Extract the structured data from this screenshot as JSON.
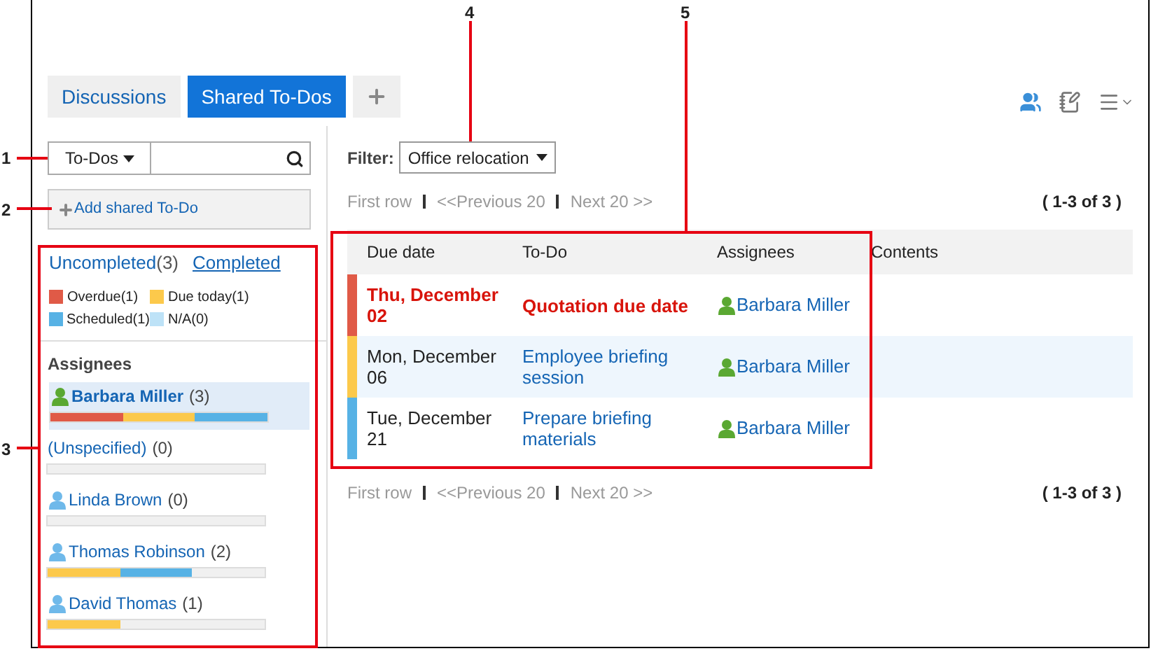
{
  "tabs": [
    {
      "label": "Discussions",
      "selected": false
    },
    {
      "label": "Shared To-Dos",
      "selected": true
    }
  ],
  "search": {
    "menu_label": "To-Dos"
  },
  "add_button": {
    "label": "Add shared To-Do"
  },
  "status_links": [
    {
      "label": "Uncompleted",
      "count": "(3)",
      "selected": true
    },
    {
      "label": "Completed",
      "selected": false
    }
  ],
  "legend": [
    {
      "label": "Overdue(1)",
      "color": "#e05a47"
    },
    {
      "label": "Due today(1)",
      "color": "#fcc94b"
    },
    {
      "label": "Scheduled(1)",
      "color": "#57b2e5"
    },
    {
      "label": "N/A(0)",
      "color": "#bde2f7"
    }
  ],
  "assignees_heading": "Assignees",
  "assignees": [
    {
      "name": "Barbara Miller",
      "count": "(3)",
      "kind": "self",
      "selected": true,
      "segments": [
        {
          "color": "#e05a47"
        },
        {
          "color": "#fcc94b"
        },
        {
          "color": "#57b2e5"
        }
      ]
    },
    {
      "name": "(Unspecified)",
      "count": "(0)",
      "kind": "none",
      "selected": false
    },
    {
      "name": "Linda Brown",
      "count": "(0)",
      "kind": "user",
      "selected": false
    },
    {
      "name": "Thomas Robinson",
      "count": "(2)",
      "kind": "user",
      "selected": false,
      "segments": [
        {
          "color": "#fcc94b"
        },
        {
          "color": "#57b2e5"
        }
      ]
    },
    {
      "name": "David Thomas",
      "count": "(1)",
      "kind": "user",
      "selected": false,
      "segments": [
        {
          "color": "#fcc94b"
        }
      ]
    }
  ],
  "filter": {
    "label": "Filter:",
    "value": "Office relocation"
  },
  "pagination": [
    {
      "first": "First row",
      "previous": "<<Previous 20",
      "next": "Next 20 >>",
      "range": "( 1-3 of 3 )"
    },
    {
      "first": "First row",
      "previous": "<<Previous 20",
      "next": "Next 20 >>",
      "range": "( 1-3 of 3 )"
    }
  ],
  "table": {
    "columns": [
      "Due date",
      "To-Do",
      "Assignees",
      "Contents"
    ],
    "rows": [
      {
        "due": "Thu, December 02",
        "todo": "Quotation due date",
        "assignee": "Barbara Miller",
        "assignee_is_self": true,
        "color": "#e05a47",
        "overdue": true
      },
      {
        "due": "Mon, December 06",
        "todo": "Employee briefing session",
        "assignee": "Barbara Miller",
        "assignee_is_self": true,
        "color": "#fcc94b",
        "overdue": false
      },
      {
        "due": "Tue, December 21",
        "todo": "Prepare briefing materials",
        "assignee": "Barbara Miller",
        "assignee_is_self": true,
        "color": "#57b2e5",
        "overdue": false
      }
    ]
  },
  "callouts": [
    {
      "label": "1"
    },
    {
      "label": "2"
    },
    {
      "label": "3"
    },
    {
      "label": "4"
    },
    {
      "label": "5"
    }
  ]
}
